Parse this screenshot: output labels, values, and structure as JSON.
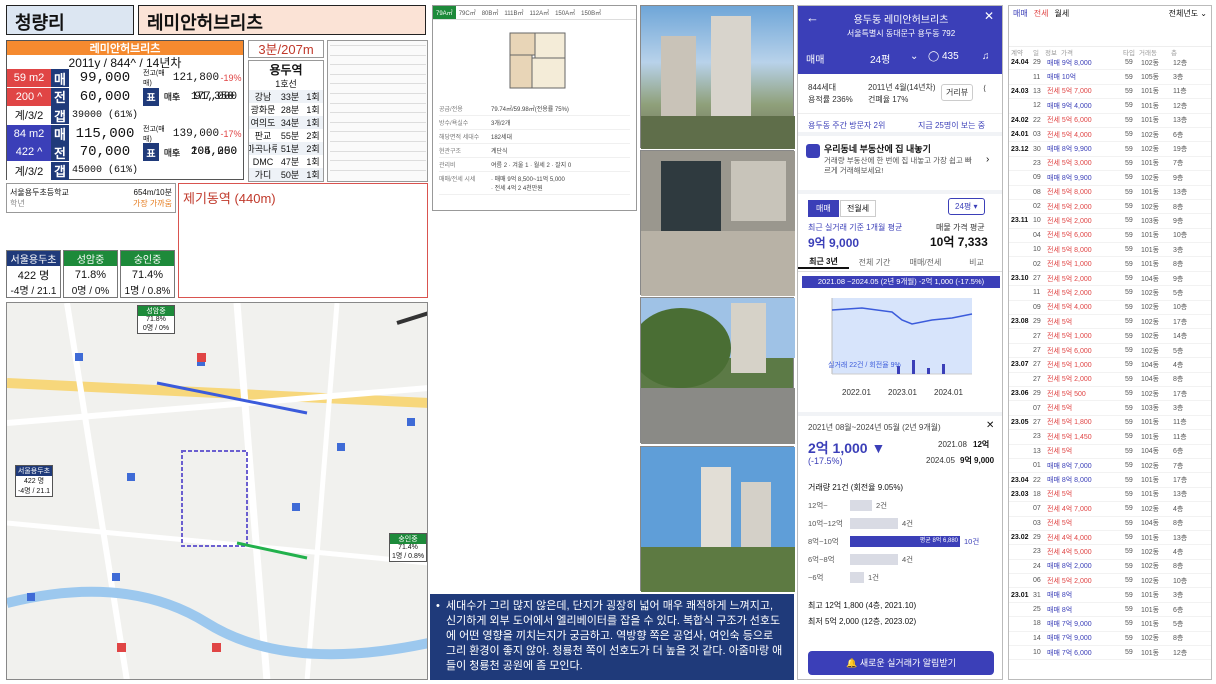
{
  "header": {
    "area": "청량리",
    "complex": "레미안허브리츠"
  },
  "summary": {
    "name": "레미안허브리츠",
    "meta": "2011y / 844^ / 14년차",
    "rows": [
      {
        "size": "59 m2",
        "label": "매",
        "price": "99,000",
        "tag": "전고(매매)",
        "high": "121,800",
        "pct": "-19%",
        "sub_label": "목",
        "sub_kind": "매수",
        "sub_val": "91,350"
      },
      {
        "size": "200 ^",
        "label": "전",
        "price": "60,000",
        "tag": "",
        "high": "",
        "pct": "",
        "sub_label": "표",
        "sub_kind": "매도",
        "sub_val": "177,000"
      },
      {
        "size": "계/3/2",
        "label": "갭",
        "price": "39000 (61%)",
        "tag": "",
        "high": "",
        "pct": "",
        "sub_label": "",
        "sub_kind": "",
        "sub_val": ""
      },
      {
        "size": "84 m2",
        "label": "매",
        "price": "115,000",
        "tag": "전고(매매)",
        "high": "139,000",
        "pct": "-17%",
        "sub_label": "목",
        "sub_kind": "매수",
        "sub_val": "104,250"
      },
      {
        "size": "422 ^",
        "label": "전",
        "price": "70,000",
        "tag": "",
        "high": "",
        "pct": "",
        "sub_label": "표",
        "sub_kind": "매도",
        "sub_val": "205,000"
      },
      {
        "size": "계/3/2",
        "label": "갭",
        "price": "45000 (61%)",
        "tag": "",
        "high": "",
        "pct": "",
        "sub_label": "",
        "sub_kind": "",
        "sub_val": ""
      }
    ],
    "school": "서울용두초등학교",
    "school_dist": "654m/10분",
    "school_sub": "학년",
    "school_sub2": "가장 가까움"
  },
  "station": {
    "walk": "3분/207m",
    "name": "용두역",
    "line": "1호선",
    "rows": [
      [
        "강남",
        "33분",
        "1회"
      ],
      [
        "광화문",
        "28분",
        "1회"
      ],
      [
        "여의도",
        "34분",
        "1회"
      ],
      [
        "판교",
        "55분",
        "2회"
      ],
      [
        "마곡나루",
        "51분",
        "2회"
      ],
      [
        "DMC",
        "47분",
        "1회"
      ],
      [
        "가디",
        "50분",
        "1회"
      ]
    ]
  },
  "stream": {
    "label": "제기동역 (440m)"
  },
  "schools": [
    {
      "name": "서울용두초",
      "v1": "422 명",
      "v2": "-4명 / 21.1",
      "color": "#1f3a7a"
    },
    {
      "name": "성암중",
      "v1": "71.8%",
      "v2": "0명 / 0%",
      "color": "#1d8a3a"
    },
    {
      "name": "숭인중",
      "v1": "71.4%",
      "v2": "1명 / 0.8%",
      "color": "#1d8a3a"
    }
  ],
  "map": {
    "labels": [
      {
        "name": "성암중",
        "a": "71.8%",
        "b": "0명 / 0%"
      },
      {
        "name": "서울용두초",
        "a": "422 명",
        "b": "-4명 / 21.1"
      },
      {
        "name": "숭인중",
        "a": "71.4%",
        "b": "1명 / 0.8%"
      }
    ]
  },
  "floorplan": {
    "tabs": [
      "79A㎡",
      "79C㎡",
      "80B㎡",
      "111B㎡",
      "112A㎡",
      "150A㎡",
      "150B㎡"
    ],
    "info": [
      [
        "공급/전용",
        "79.74㎡/59.98㎡(전용률 75%)"
      ],
      [
        "방수/욕실수",
        "3개/2개"
      ],
      [
        "해당면적 세대수",
        "182세대"
      ],
      [
        "현관구조",
        "계단식"
      ],
      [
        "관리비",
        "여름 2 · 겨울 1 · 월세 2 · 잘지 0"
      ],
      [
        "매매/전세 시세",
        "· 매매 9억 8,500~11억 5,000\n· 전세 4억 2 4천만원"
      ]
    ]
  },
  "notes": "세대수가 그리 많지 않은데, 단지가 굉장히 넓어 매우 쾌적하게 느껴지고, 신기하게 외부 도어에서 엘리베이터를 잡을 수 있다. 복합식 구조가 선호도에 어떤 영향을 끼치는지가 궁금하고. 역방향 쪽은 공업사, 여인숙 등으로 그리 환경이 좋지 않아. 청룡천 쪽이 선호도가 더 높을 것 같다. 아줌마랑 애들이 청룡천 공원에 좀 모인다.",
  "app": {
    "title": "용두동 레미안허브리츠",
    "address": "서울특별시 동대문구 용두동 792",
    "tabs": [
      "매매",
      "24평",
      "435"
    ],
    "stats": [
      "844세대",
      "2011년 4월(14년차)",
      "용적률 236%",
      "건폐율 17%"
    ],
    "nearby": "거리뷰",
    "visitors": "용두동 주간 방문자 2위",
    "visitors_link": "지금 25명이 보는 중",
    "promo_title": "우리동네 부동산에 집 내놓기",
    "promo_text": "거래량 부동산에 한 번에 집 내놓고 가장 쉽고 빠르게 거래해보세요!",
    "deal_tabs": [
      "매매",
      "전월세"
    ],
    "size": "24평",
    "recent_label": "최근 실거래 기준 1개월 평균",
    "recent_val": "9억 9,000",
    "ask_label": "매물 가격 평균",
    "ask_val": "10억 7,333",
    "chart_tabs": [
      "최근 3년",
      "전체 기간",
      "매매/전세",
      "비교"
    ],
    "chart_banner": "2021.08 ~2024.05 (2년 9개월) -2억 1,000 (-17.5%)",
    "chart_note": "실거래 22건 / 회전율 9%",
    "x_ticks": [
      "2022.01",
      "2023.01",
      "2024.01"
    ],
    "period": "2021년 08월~2024년 05월 (2년 9개월)",
    "delta": "2억 1,000 ▼",
    "delta_pct": "(-17.5%)",
    "from_date": "2021.08",
    "from_val": "12억",
    "to_date": "2024.05",
    "to_val": "9억 9,000",
    "volume": "거래량 21건 (회전율 9.05%)",
    "dist": [
      [
        "12억~",
        "2건"
      ],
      [
        "10억~12억",
        "4건"
      ],
      [
        "8억~10억",
        "10건"
      ],
      [
        "6억~8억",
        "4건"
      ],
      [
        "~6억",
        "1건"
      ]
    ],
    "dist_highlight": "평균 8억 6,880",
    "max": "최고 12억 1,800 (4층, 2021.10)",
    "min": "최저 5억 2,000 (12층, 2023.02)",
    "cta": "새로운 실거래가 알림받기"
  },
  "trades": {
    "tabs": [
      "매매",
      "전세",
      "월세"
    ],
    "filter": "전체년도",
    "col_heads": [
      "계약",
      "일",
      "정보",
      "가격",
      "타입",
      "거래동",
      "층"
    ],
    "rows": [
      [
        "24.04",
        "29",
        "매매 9억 8,000",
        "59",
        "102동",
        "12층"
      ],
      [
        "",
        "11",
        "매매 10억",
        "59",
        "105동",
        "3층"
      ],
      [
        "24.03",
        "13",
        "전세 5억 7,000",
        "59",
        "101동",
        "11층"
      ],
      [
        "",
        "12",
        "매매 9억 4,000",
        "59",
        "101동",
        "12층"
      ],
      [
        "24.02",
        "22",
        "전세 5억 6,000",
        "59",
        "101동",
        "13층"
      ],
      [
        "24.01",
        "03",
        "전세 5억 4,000",
        "59",
        "102동",
        "6층"
      ],
      [
        "23.12",
        "30",
        "매매 8억 9,900",
        "59",
        "102동",
        "19층"
      ],
      [
        "",
        "23",
        "전세 5억 3,000",
        "59",
        "101동",
        "7층"
      ],
      [
        "",
        "09",
        "매매 8억 9,900",
        "59",
        "102동",
        "9층"
      ],
      [
        "",
        "08",
        "전세 5억 8,000",
        "59",
        "101동",
        "13층"
      ],
      [
        "",
        "02",
        "전세 5억 2,000",
        "59",
        "102동",
        "8층"
      ],
      [
        "23.11",
        "10",
        "전세 5억 2,000",
        "59",
        "103동",
        "9층"
      ],
      [
        "",
        "04",
        "전세 5억 6,000",
        "59",
        "101동",
        "10층"
      ],
      [
        "",
        "10",
        "전세 5억 8,000",
        "59",
        "101동",
        "3층"
      ],
      [
        "",
        "02",
        "전세 5억 1,000",
        "59",
        "101동",
        "8층"
      ],
      [
        "23.10",
        "27",
        "전세 5억 2,000",
        "59",
        "104동",
        "9층"
      ],
      [
        "",
        "11",
        "전세 5억 2,000",
        "59",
        "102동",
        "5층"
      ],
      [
        "",
        "09",
        "전세 5억 4,000",
        "59",
        "102동",
        "10층"
      ],
      [
        "23.08",
        "29",
        "전세 5억",
        "59",
        "102동",
        "17층"
      ],
      [
        "",
        "27",
        "전세 5억 1,000",
        "59",
        "102동",
        "14층"
      ],
      [
        "",
        "27",
        "전세 5억 6,000",
        "59",
        "102동",
        "5층"
      ],
      [
        "23.07",
        "27",
        "전세 5억 1,000",
        "59",
        "104동",
        "4층"
      ],
      [
        "",
        "27",
        "전세 5억 2,000",
        "59",
        "104동",
        "8층"
      ],
      [
        "23.06",
        "29",
        "전세 5억 500",
        "59",
        "102동",
        "17층"
      ],
      [
        "",
        "07",
        "전세 5억",
        "59",
        "103동",
        "3층"
      ],
      [
        "23.05",
        "27",
        "전세 5억 1,800",
        "59",
        "101동",
        "11층"
      ],
      [
        "",
        "23",
        "전세 5억 1,450",
        "59",
        "101동",
        "11층"
      ],
      [
        "",
        "13",
        "전세 5억",
        "59",
        "104동",
        "6층"
      ],
      [
        "",
        "01",
        "매매 8억 7,000",
        "59",
        "102동",
        "7층"
      ],
      [
        "23.04",
        "22",
        "매매 8억 8,000",
        "59",
        "101동",
        "17층"
      ],
      [
        "23.03",
        "18",
        "전세 5억",
        "59",
        "101동",
        "13층"
      ],
      [
        "",
        "07",
        "전세 4억 7,000",
        "59",
        "102동",
        "4층"
      ],
      [
        "",
        "03",
        "전세 5억",
        "59",
        "104동",
        "8층"
      ],
      [
        "23.02",
        "29",
        "전세 4억 4,000",
        "59",
        "101동",
        "13층"
      ],
      [
        "",
        "23",
        "전세 4억 5,000",
        "59",
        "102동",
        "4층"
      ],
      [
        "",
        "24",
        "매매 8억 2,000",
        "59",
        "102동",
        "8층"
      ],
      [
        "",
        "06",
        "전세 5억 2,000",
        "59",
        "102동",
        "10층"
      ],
      [
        "23.01",
        "31",
        "매매 8억",
        "59",
        "101동",
        "3층"
      ],
      [
        "",
        "25",
        "매매 8억",
        "59",
        "101동",
        "6층"
      ],
      [
        "",
        "18",
        "매매 7억 9,000",
        "59",
        "101동",
        "5층"
      ],
      [
        "",
        "14",
        "매매 7억 9,000",
        "59",
        "102동",
        "8층"
      ],
      [
        "",
        "10",
        "매매 7억 6,000",
        "59",
        "101동",
        "12층"
      ]
    ]
  }
}
